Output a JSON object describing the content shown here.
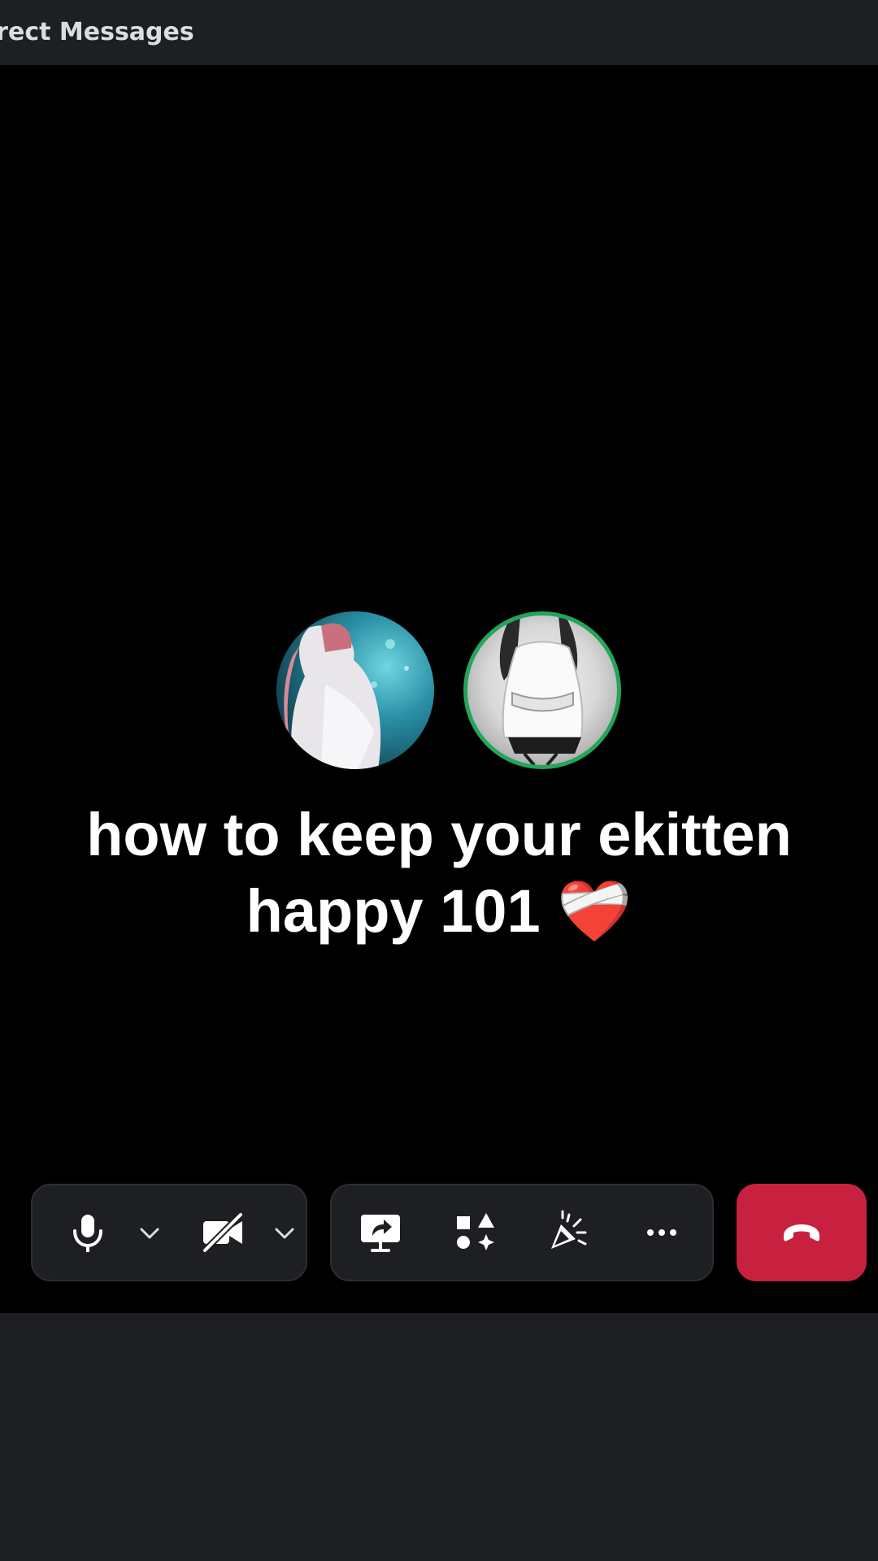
{
  "header": {
    "title": "Direct Messages"
  },
  "call": {
    "participants": [
      {
        "name_icon": "avatar",
        "speaking": false
      },
      {
        "name_icon": "avatar",
        "speaking": true
      }
    ],
    "caption": "how to keep your ekitten happy 101 ❤️‍🩹"
  },
  "controls": {
    "audio_video_group": [
      "microphone-icon",
      "chevron-down-icon",
      "camera-off-icon",
      "chevron-down-icon"
    ],
    "activity_group": [
      "screen-share-icon",
      "activities-icon",
      "soundboard-icon",
      "more-icon"
    ],
    "hangup": "hang-up-icon"
  },
  "colors": {
    "background": "#000000",
    "panel": "#1e1f22",
    "speaking_ring": "#23a55a",
    "hangup": "#c8203f",
    "text": "#ffffff"
  }
}
